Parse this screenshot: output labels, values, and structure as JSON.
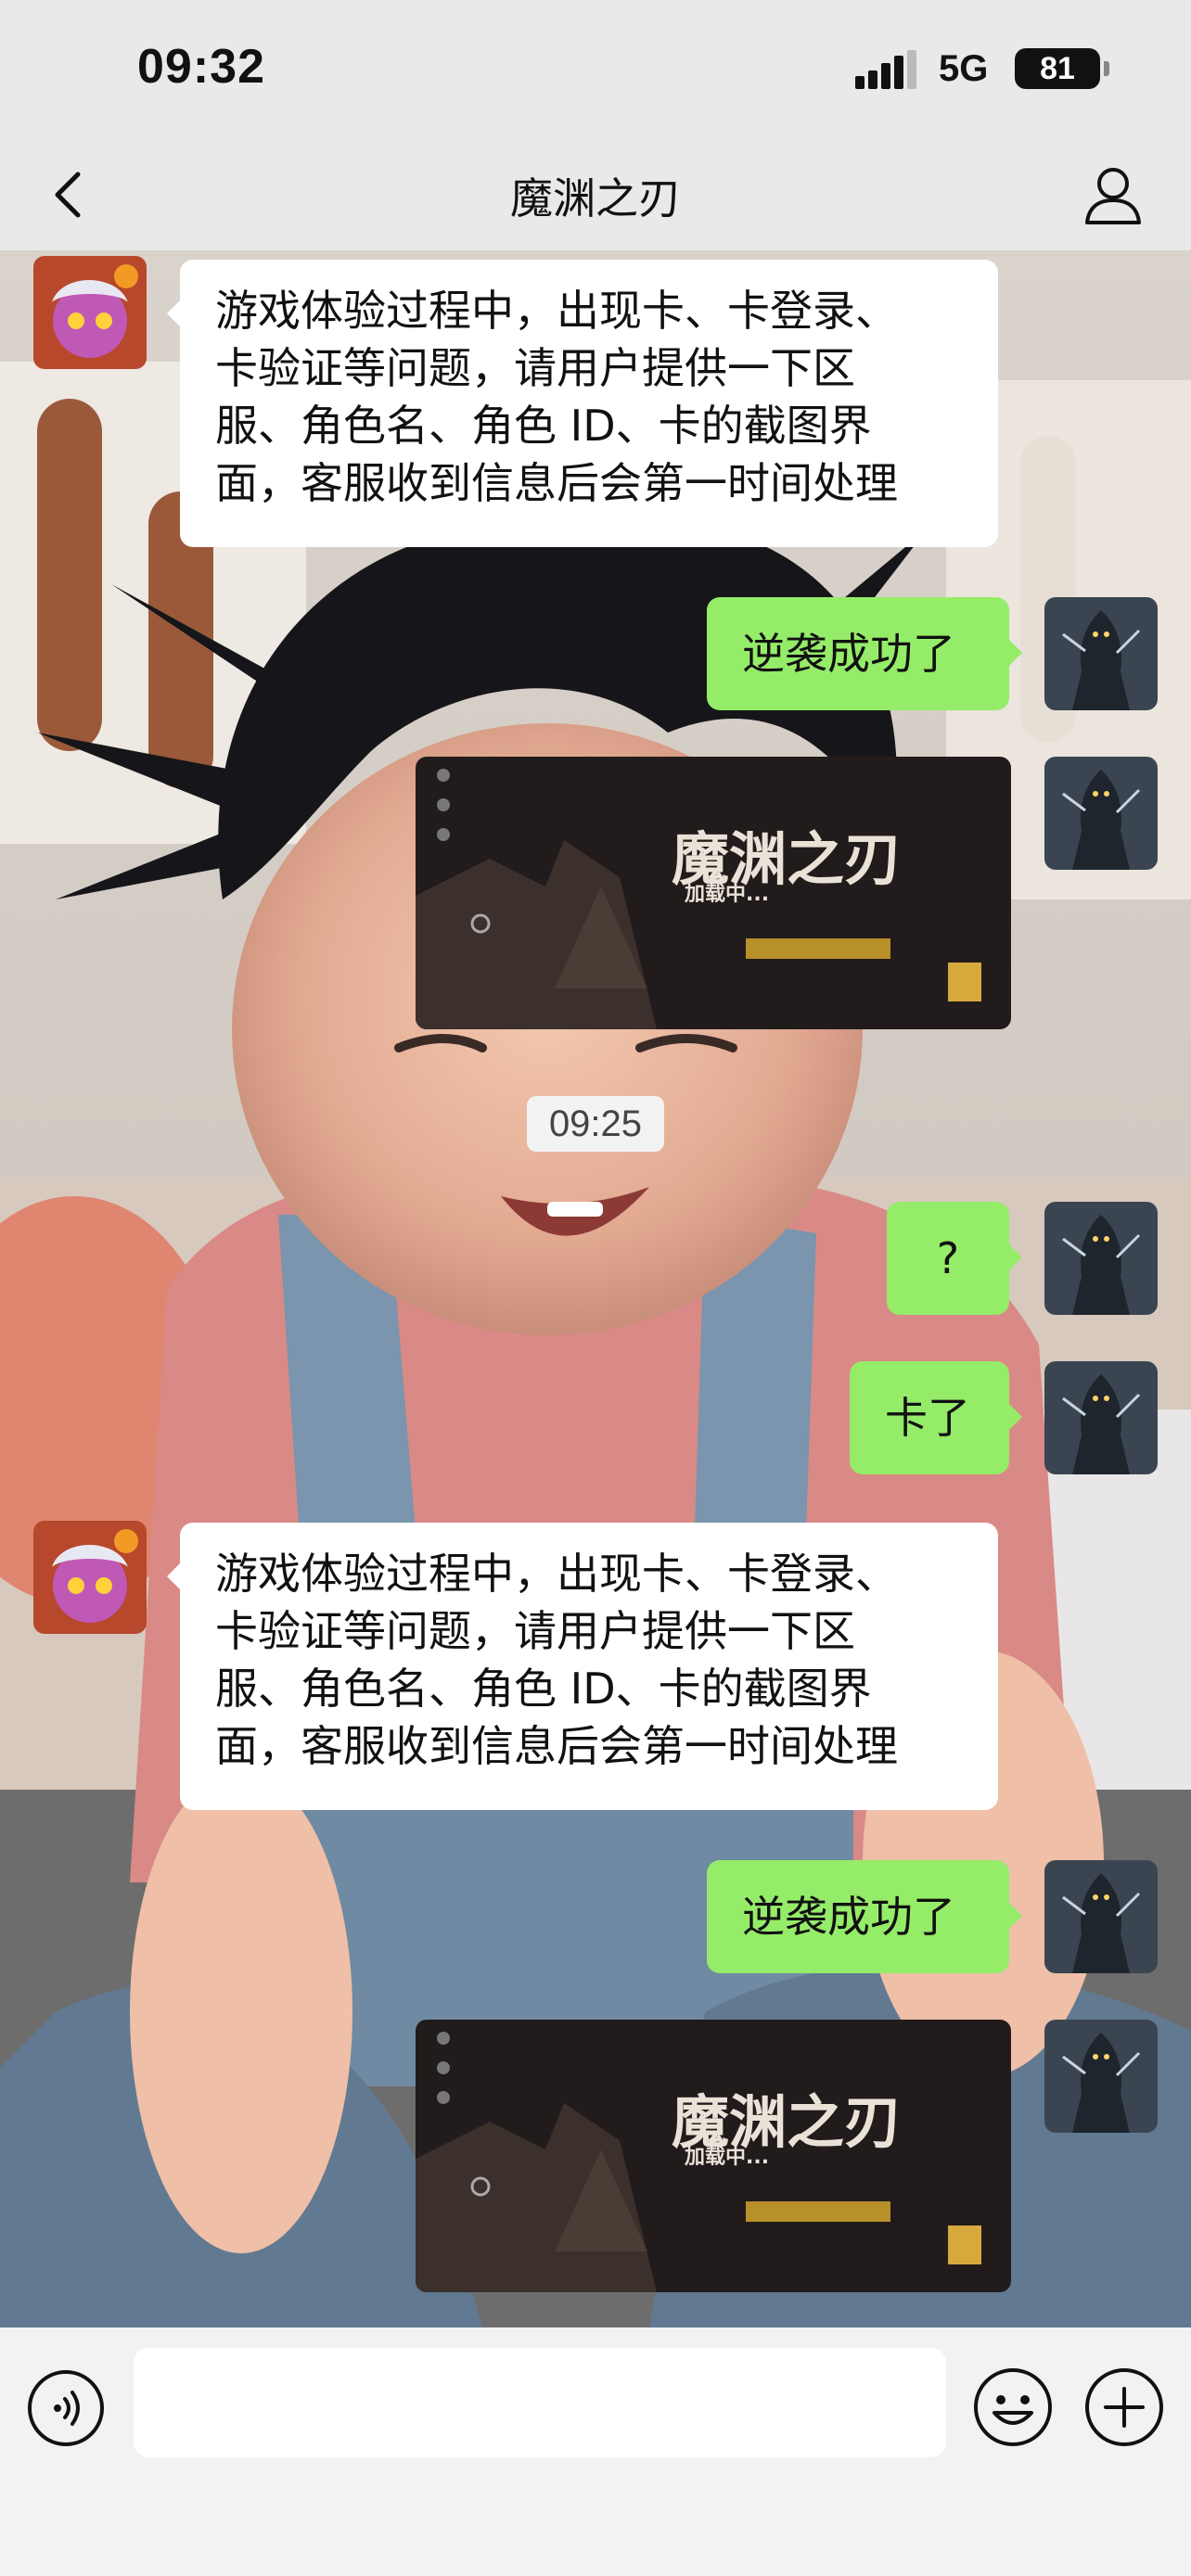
{
  "status_bar": {
    "time": "09:32",
    "network": "5G",
    "battery": "81"
  },
  "nav": {
    "title": "魔渊之刃",
    "back_icon": "chevron-left-icon",
    "profile_icon": "person-icon"
  },
  "messages": [
    {
      "from": "service",
      "type": "text",
      "lines": [
        "游戏体验过程中，出现卡、卡登录、",
        "卡验证等问题，请用户提供一下区",
        "服、角色名、角色 ID、卡的截图界",
        "面，客服收到信息后会第一时间处理"
      ]
    },
    {
      "from": "me",
      "type": "text",
      "text": "逆袭成功了"
    },
    {
      "from": "me",
      "type": "image",
      "image_title": "魔渊之刃",
      "loading_text": "加载中..."
    },
    {
      "from": "me",
      "type": "text",
      "text": "?"
    },
    {
      "from": "me",
      "type": "text",
      "text": "卡了"
    },
    {
      "from": "service",
      "type": "text",
      "lines": [
        "游戏体验过程中，出现卡、卡登录、",
        "卡验证等问题，请用户提供一下区",
        "服、角色名、角色 ID、卡的截图界",
        "面，客服收到信息后会第一时间处理"
      ]
    },
    {
      "from": "me",
      "type": "text",
      "text": "逆袭成功了"
    },
    {
      "from": "me",
      "type": "image",
      "image_title": "魔渊之刃",
      "loading_text": "加载中..."
    }
  ],
  "timestamp": "09:25",
  "input_bar": {
    "voice_icon": "voice-icon",
    "input_value": "",
    "emoji_icon": "emoji-icon",
    "plus_icon": "plus-icon"
  },
  "colors": {
    "outgoing_bubble": "#95ec69",
    "incoming_bubble": "#ffffff",
    "bar_background": "#e9e9e9"
  }
}
